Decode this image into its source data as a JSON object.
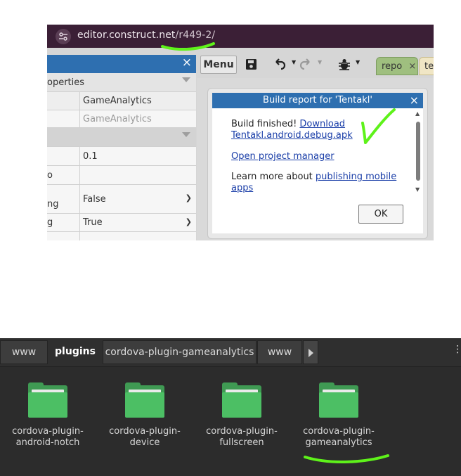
{
  "browser": {
    "url_host": "editor.construct.net",
    "url_path": "/r449-2/"
  },
  "properties_panel": {
    "close_icon": "×",
    "rows": [
      {
        "label": "operties",
        "value": "",
        "type": "header"
      },
      {
        "label": "",
        "value": "GameAnalytics"
      },
      {
        "label": "",
        "value": "GameAnalytics",
        "muted": true
      },
      {
        "label": "",
        "value": "",
        "type": "section"
      },
      {
        "label": "",
        "value": "0.1"
      },
      {
        "label": "o",
        "value": ""
      },
      {
        "label": "ng",
        "value": "False",
        "dropdown": true
      },
      {
        "label": "g",
        "value": "True",
        "dropdown": true
      },
      {
        "label": "",
        "value": ""
      }
    ]
  },
  "toolbar": {
    "menu_label": "Menu",
    "tabs": [
      {
        "label": "repo",
        "close": "×"
      },
      {
        "label": "tes"
      }
    ]
  },
  "dialog": {
    "title": "Build report for 'Tentakl'",
    "close_icon": "×",
    "finished_text": "Build finished!",
    "download_link_1": "Download",
    "download_link_2": "Tentakl.android.debug.apk",
    "project_manager_link": "Open project manager",
    "learn_more_text": "Learn more about",
    "publishing_link_1": "publishing mobile",
    "publishing_link_2": "apps",
    "ok_label": "OK"
  },
  "file_manager": {
    "breadcrumbs": [
      {
        "label": "www",
        "active": false
      },
      {
        "label": "plugins",
        "active": true
      },
      {
        "label": "cordova-plugin-gameanalytics",
        "active": false
      },
      {
        "label": "www",
        "active": false
      }
    ],
    "more_icon": "⋮",
    "folders": [
      {
        "line1": "cordova-plugin-",
        "line2": "android-notch"
      },
      {
        "line1": "cordova-plugin-",
        "line2": "device"
      },
      {
        "line1": "cordova-plugin-",
        "line2": "fullscreen"
      },
      {
        "line1": "cordova-plugin-",
        "line2": "gameanalytics"
      }
    ]
  },
  "colors": {
    "accent_blue": "#2e6fb0",
    "marker_green": "#5ef21a",
    "folder_green": "#4cbf64",
    "address_bar": "#3b1f36"
  }
}
